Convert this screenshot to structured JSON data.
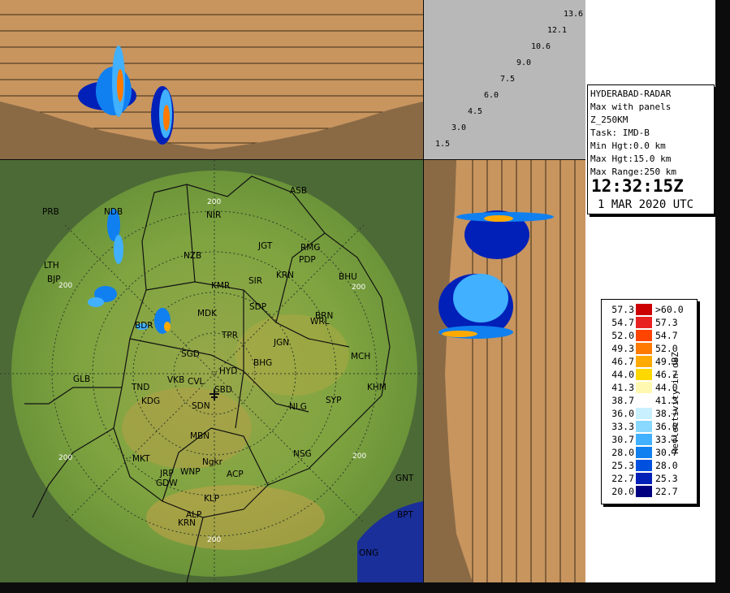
{
  "info": {
    "station": "HYDERABAD-RADAR",
    "product": "Max with panels",
    "field": "Z_250KM",
    "task": "Task: IMD-B",
    "min_hgt": "Min Hgt:0.0 km",
    "max_hgt": "Max Hgt:15.0 km",
    "max_range": "Max Range:250 km",
    "time": "12:32:15Z",
    "date": "1 MAR 2020 UTC"
  },
  "height_scale": [
    "13.6",
    "12.1",
    "10.6",
    "9.0",
    "7.5",
    "6.0",
    "4.5",
    "3.0",
    "1.5"
  ],
  "legend": {
    "title": "Reflectivity in dBZ",
    "rows": [
      {
        "lo": "57.3",
        "hi": ">60.0",
        "color": "#cc0000"
      },
      {
        "lo": "54.7",
        "hi": "57.3",
        "color": "#e82020"
      },
      {
        "lo": "52.0",
        "hi": "54.7",
        "color": "#ff4400"
      },
      {
        "lo": "49.3",
        "hi": "52.0",
        "color": "#ff7a00"
      },
      {
        "lo": "46.7",
        "hi": "49.3",
        "color": "#ffaa00"
      },
      {
        "lo": "44.0",
        "hi": "46.7",
        "color": "#ffd800"
      },
      {
        "lo": "41.3",
        "hi": "44.0",
        "color": "#fff8b0"
      },
      {
        "lo": "38.7",
        "hi": "41.3",
        "color": "#ffffff"
      },
      {
        "lo": "36.0",
        "hi": "38.7",
        "color": "#c8f0ff"
      },
      {
        "lo": "33.3",
        "hi": "36.0",
        "color": "#88d8ff"
      },
      {
        "lo": "30.7",
        "hi": "33.3",
        "color": "#40b0ff"
      },
      {
        "lo": "28.0",
        "hi": "30.7",
        "color": "#1080f0"
      },
      {
        "lo": "25.3",
        "hi": "28.0",
        "color": "#0050e0"
      },
      {
        "lo": "22.7",
        "hi": "25.3",
        "color": "#0020b8"
      },
      {
        "lo": "20.0",
        "hi": "22.7",
        "color": "#000080"
      }
    ]
  },
  "range_ring_label": "200",
  "cities": [
    {
      "code": "PRB"
    },
    {
      "code": "NDB"
    },
    {
      "code": "NIR"
    },
    {
      "code": "ASB"
    },
    {
      "code": "LTH"
    },
    {
      "code": "BJP"
    },
    {
      "code": "NZB"
    },
    {
      "code": "JGT"
    },
    {
      "code": "RMG"
    },
    {
      "code": "PDP"
    },
    {
      "code": "KRN"
    },
    {
      "code": "BHU"
    },
    {
      "code": "KMR"
    },
    {
      "code": "SIR"
    },
    {
      "code": "MDK"
    },
    {
      "code": "SDP"
    },
    {
      "code": "BRN"
    },
    {
      "code": "WRL"
    },
    {
      "code": "BDR"
    },
    {
      "code": "TPR"
    },
    {
      "code": "JGN"
    },
    {
      "code": "MCH"
    },
    {
      "code": "SGD"
    },
    {
      "code": "HYD"
    },
    {
      "code": "BHG"
    },
    {
      "code": "GLB"
    },
    {
      "code": "TND"
    },
    {
      "code": "VKB"
    },
    {
      "code": "CVL"
    },
    {
      "code": "SBD"
    },
    {
      "code": "KHM"
    },
    {
      "code": "KDG"
    },
    {
      "code": "SDN"
    },
    {
      "code": "NLG"
    },
    {
      "code": "SYP"
    },
    {
      "code": "MBN"
    },
    {
      "code": "MKT"
    },
    {
      "code": "Ngkr"
    },
    {
      "code": "NSG"
    },
    {
      "code": "JRP"
    },
    {
      "code": "WNP"
    },
    {
      "code": "GDW"
    },
    {
      "code": "ACP"
    },
    {
      "code": "GNT"
    },
    {
      "code": "KLP"
    },
    {
      "code": "ALP"
    },
    {
      "code": "KRN"
    },
    {
      "code": "BPT"
    },
    {
      "code": "ONG"
    }
  ]
}
